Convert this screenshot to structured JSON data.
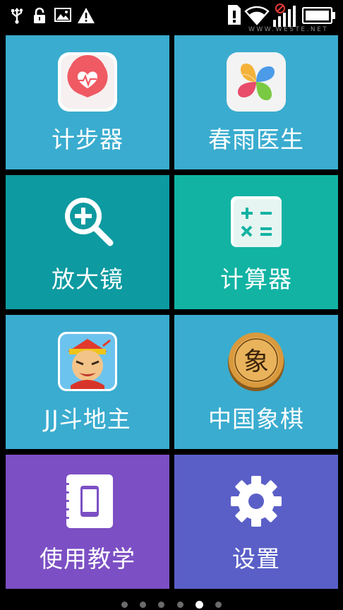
{
  "watermark": "WWW.WESTE.NET",
  "status_bar": {
    "icons_left": [
      "usb-icon",
      "lock-icon",
      "image-icon",
      "warning-icon"
    ],
    "icons_right": [
      "sim-icon",
      "wifi-icon",
      "signal-icon",
      "battery-icon"
    ]
  },
  "tiles": [
    {
      "label": "计步器",
      "icon": "heart-pedometer-icon",
      "color": "#3aaccf"
    },
    {
      "label": "春雨医生",
      "icon": "clover-icon",
      "color": "#3aaccf"
    },
    {
      "label": "放大镜",
      "icon": "magnifier-icon",
      "color": "#0d9aa0"
    },
    {
      "label": "计算器",
      "icon": "calculator-icon",
      "color": "#12b3a3"
    },
    {
      "label": "JJ斗地主",
      "icon": "game-character-icon",
      "color": "#3aaccf"
    },
    {
      "label": "中国象棋",
      "icon": "chess-piece-icon",
      "color": "#3aaccf"
    },
    {
      "label": "使用教学",
      "icon": "phone-notebook-icon",
      "color": "#7c4fc4"
    },
    {
      "label": "设置",
      "icon": "gear-icon",
      "color": "#5a5fc7"
    }
  ],
  "chess_glyph": "象",
  "page_indicator": {
    "count": 6,
    "active_index": 4
  }
}
